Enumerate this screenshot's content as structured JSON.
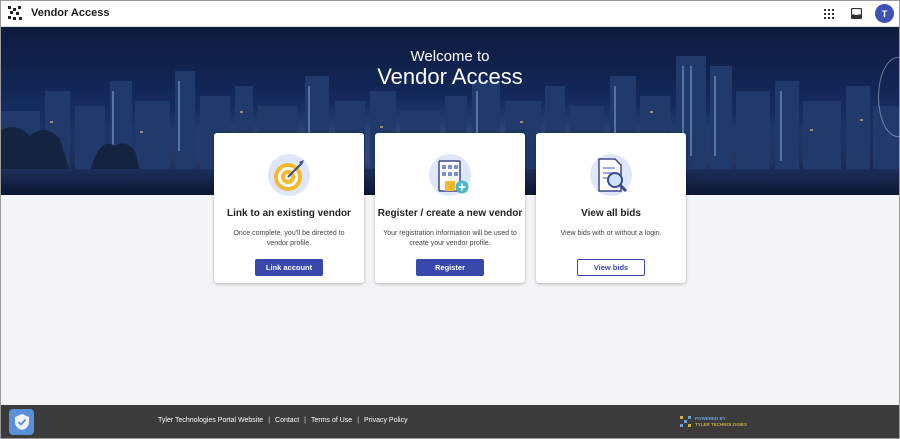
{
  "header": {
    "app_title": "Vendor Access",
    "avatar_initial": "T"
  },
  "hero": {
    "line1": "Welcome to",
    "line2": "Vendor Access"
  },
  "cards": [
    {
      "title": "Link to an existing vendor",
      "description": "Once complete, you'll be directed to vendor profile.",
      "button": "Link account",
      "icon": "target-icon"
    },
    {
      "title": "Register / create a new vendor",
      "description": "Your registration information will be used to create your vendor profile.",
      "button": "Register",
      "icon": "building-add-icon"
    },
    {
      "title": "View all bids",
      "description": "View bids with or without a login.",
      "button": "View bids",
      "icon": "document-search-icon"
    }
  ],
  "footer": {
    "links": [
      "Tyler Technologies Portal Website",
      "Contact",
      "Terms of Use",
      "Privacy Policy"
    ],
    "powered_line1": "POWERED BY",
    "powered_line2": "TYLER TECHNOLOGIES"
  },
  "colors": {
    "accent": "#3949ab",
    "hero_dark": "#0e1b3c",
    "footer_bg": "#3b3b3b"
  }
}
